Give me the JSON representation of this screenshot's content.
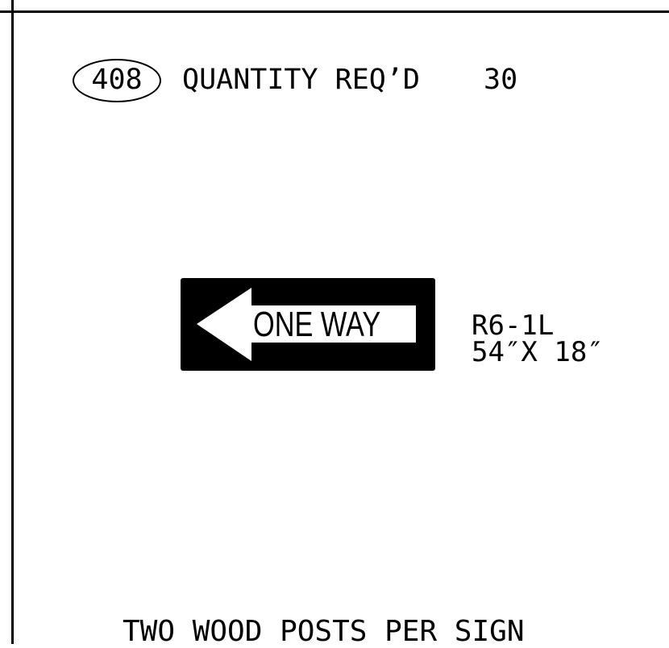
{
  "callout": {
    "number": "408"
  },
  "quantity": {
    "label": "QUANTITY REQ’D",
    "value": "30"
  },
  "sign": {
    "legend": "ONE WAY",
    "arrow_direction": "left",
    "code": "R6-1L",
    "size": "54″X 18″",
    "colors": {
      "background": "#000000",
      "legend": "#ffffff"
    }
  },
  "note": "TWO WOOD POSTS PER SIGN"
}
